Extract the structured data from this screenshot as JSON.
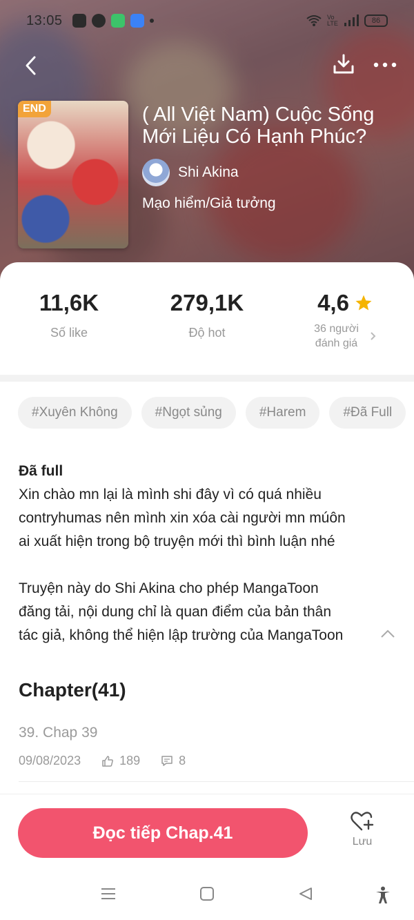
{
  "status_bar": {
    "time": "13:05",
    "network_label": "Vo LTE",
    "battery": "86",
    "icons": [
      "app-icon",
      "messenger-icon",
      "phone-app-icon",
      "browser-icon",
      "dot-icon",
      "wifi-icon",
      "signal-icon",
      "battery-icon"
    ]
  },
  "topnav": {
    "icons": [
      "back-icon",
      "download-icon",
      "more-icon"
    ]
  },
  "book": {
    "badge": "END",
    "title": "( All Việt Nam) Cuộc Sống Mới Liệu Có Hạnh Phúc?",
    "author": "Shi Akina",
    "genre": "Mạo hiểm/Giả tưởng"
  },
  "stats": {
    "likes_value": "11,6K",
    "likes_label": "Số like",
    "hot_value": "279,1K",
    "hot_label": "Độ hot",
    "rating_value": "4,6",
    "rating_line1": "36 người",
    "rating_line2": "đánh giá"
  },
  "tags": [
    "#Xuyên Không",
    "#Ngọt sủng",
    "#Harem",
    "#Đã Full"
  ],
  "description": {
    "heading": "Đã full",
    "line1": "Xin chào mn lại là mình shi đây vì có quá nhiều",
    "line2": "contryhumas nên mình xin xóa cài người mn múôn",
    "line3": "ai xuất hiện trong bộ truyện mới thì bình luận nhé",
    "line4": "Truyện này do  Shi Akina  cho phép MangaToon",
    "line5": "đăng tải, nội dung chỉ là quan điểm của bản thân",
    "line6": "tác giả, không thể hiện lập trường của MangaToon"
  },
  "chapters": {
    "title": "Chapter(41)",
    "latest_name": "39. Chap 39",
    "latest_date": "09/08/2023",
    "latest_likes": "189",
    "latest_comments": "8"
  },
  "actions": {
    "read_label": "Đọc tiếp Chap.41",
    "save_label": "Lưu"
  },
  "colors": {
    "accent": "#f2546e",
    "badge": "#f2a33a",
    "star": "#f5b400"
  }
}
